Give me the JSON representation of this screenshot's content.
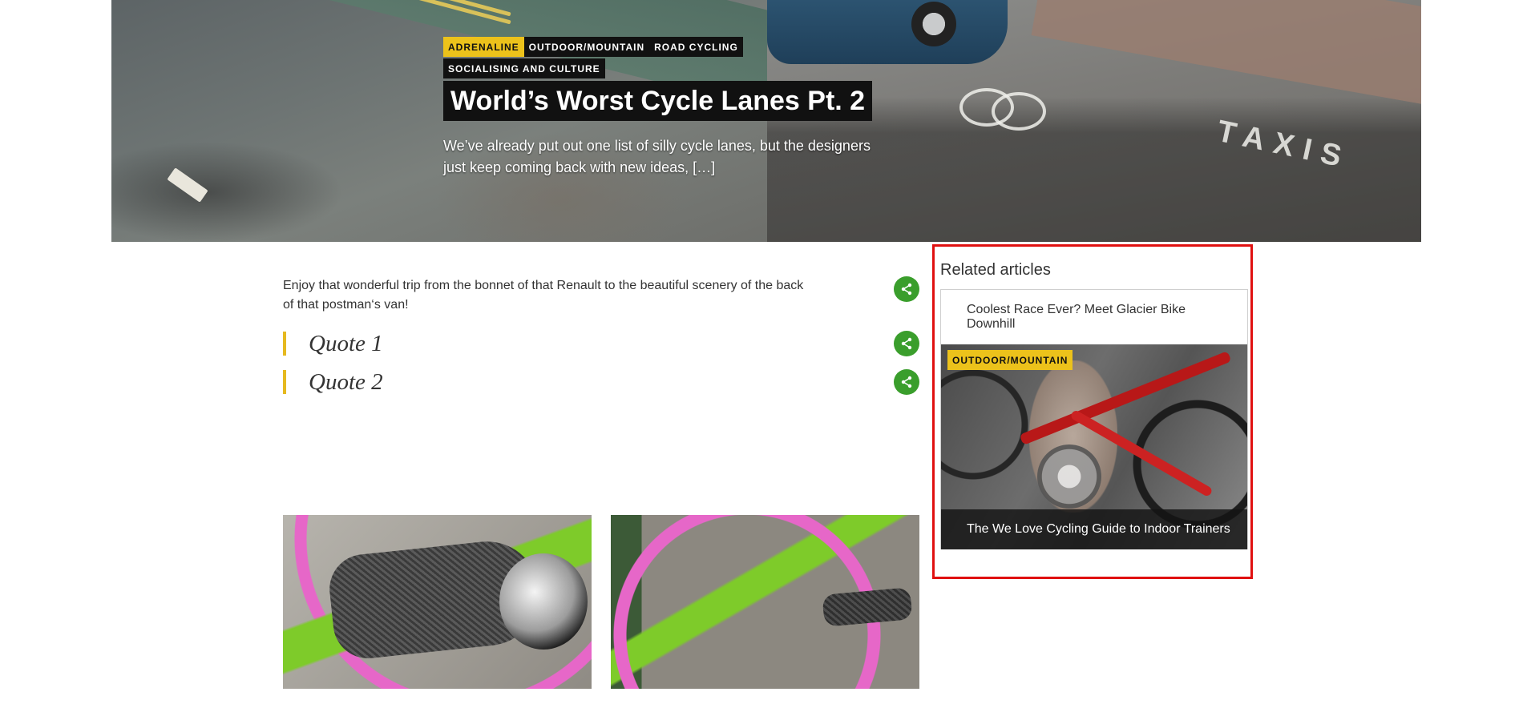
{
  "hero": {
    "tags_row1": [
      {
        "label": "Adrenaline",
        "style": "yellow"
      },
      {
        "label": "Outdoor/Mountain",
        "style": "dark"
      },
      {
        "label": "Road Cycling",
        "style": "dark"
      }
    ],
    "tags_row2": [
      {
        "label": "Socialising and Culture",
        "style": "dark"
      }
    ],
    "title": "World’s Worst Cycle Lanes Pt. 2",
    "excerpt": "We’ve already put out one list of silly cycle lanes, but the designers just keep coming back with new ideas, […]",
    "image_text": "TAXIS"
  },
  "article": {
    "body": "Enjoy that wonderful trip from the bonnet of that Renault to the beautiful scenery of the back of that postman‘s van!",
    "quotes": [
      "Quote 1",
      "Quote 2"
    ],
    "share_icon": "share-icon"
  },
  "sidebar": {
    "heading": "Related articles",
    "items": [
      {
        "title": "Coolest Race Ever? Meet Glacier Bike Downhill"
      },
      {
        "title": "The We Love Cycling Guide to Indoor Trainers",
        "tag": "Outdoor/Mountain"
      }
    ]
  },
  "colors": {
    "accent_yellow": "#ecc21b",
    "share_green": "#3a9e2c",
    "highlight_red": "#e01010"
  }
}
